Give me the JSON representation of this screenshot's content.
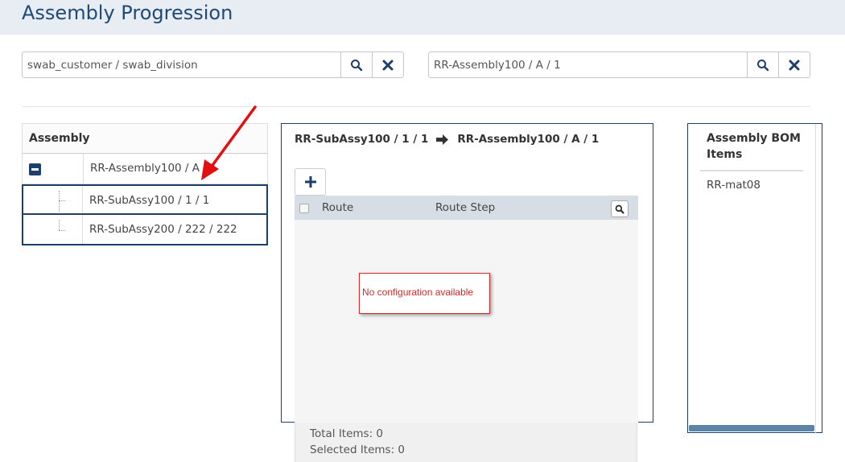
{
  "page": {
    "title": "Assembly Progression"
  },
  "search_left": {
    "value": "swab_customer / swab_division"
  },
  "search_right": {
    "value": "RR-Assembly100 / A / 1"
  },
  "assembly": {
    "header": "Assembly",
    "rows": [
      {
        "label": "RR-Assembly100 / A / 1",
        "expanded": true
      },
      {
        "label": "RR-SubAssy100 / 1 / 1",
        "selected": true
      },
      {
        "label": "RR-SubAssy200 / 222 / 222",
        "selected": true
      }
    ]
  },
  "route_panel": {
    "breadcrumb_from": "RR-SubAssy100 / 1 / 1",
    "breadcrumb_to": "RR-Assembly100 / A / 1",
    "columns": {
      "route": "Route",
      "route_step": "Route Step"
    },
    "empty_message": "No configuration available",
    "total_items": "Total Items: 0",
    "selected_items": "Selected Items: 0"
  },
  "bom_panel": {
    "title": "Assembly BOM Items",
    "items": [
      "RR-mat08"
    ]
  },
  "colors": {
    "accent": "#1e3f6b",
    "title": "#1f4a78",
    "header_bg": "#e8ecf3",
    "error": "#d42a2a",
    "annotation_arrow": "#e31010"
  },
  "icons": {
    "search": "search-icon",
    "clear": "close-icon",
    "add": "plus-icon",
    "collapse": "minus-square-icon",
    "arrow": "arrow-right-icon"
  }
}
